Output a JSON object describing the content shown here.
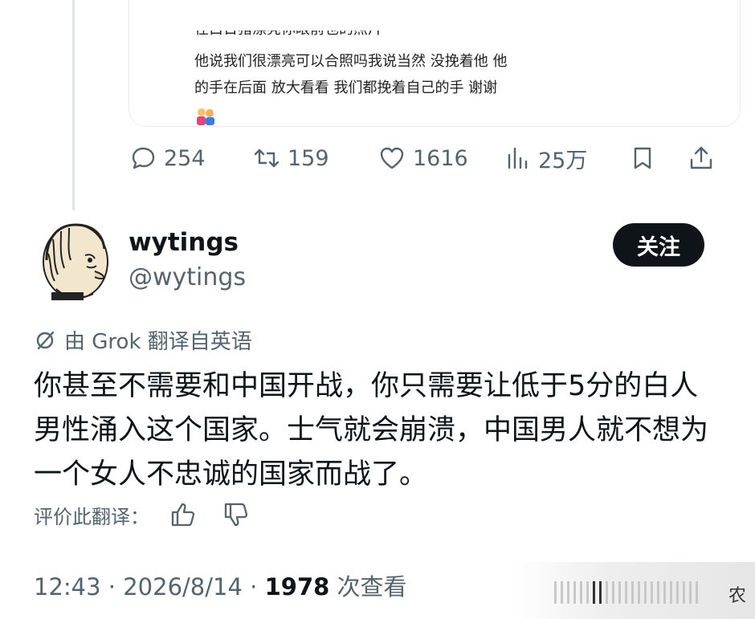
{
  "quoted_post": {
    "partial_line": "在白日猪漂亮你眼前也的照片",
    "lines": [
      "他说我们很漂亮可以合照吗我说当然 没挽着他 他",
      "的手在后面 放大看看 我们都挽着自己的手 谢谢"
    ],
    "emoji_icon": "couple-emoji-icon"
  },
  "actions": {
    "replies": "254",
    "reposts": "159",
    "likes": "1616",
    "views": "25万"
  },
  "post": {
    "display_name": "wytings",
    "handle": "@wytings",
    "follow_label": "关注",
    "translation_note": "由 Grok 翻译自英语",
    "text": "你甚至不需要和中国开战，你只需要让低于5分的白人男性涌入这个国家。士气就会崩溃，中国男人就不想为一个女人不忠诚的国家而战了。",
    "rate_label": "评价此翻译：",
    "time": "12:43",
    "date": "2026/8/14",
    "view_count": "1978",
    "view_suffix": "次查看"
  },
  "watermark_corner": "农"
}
